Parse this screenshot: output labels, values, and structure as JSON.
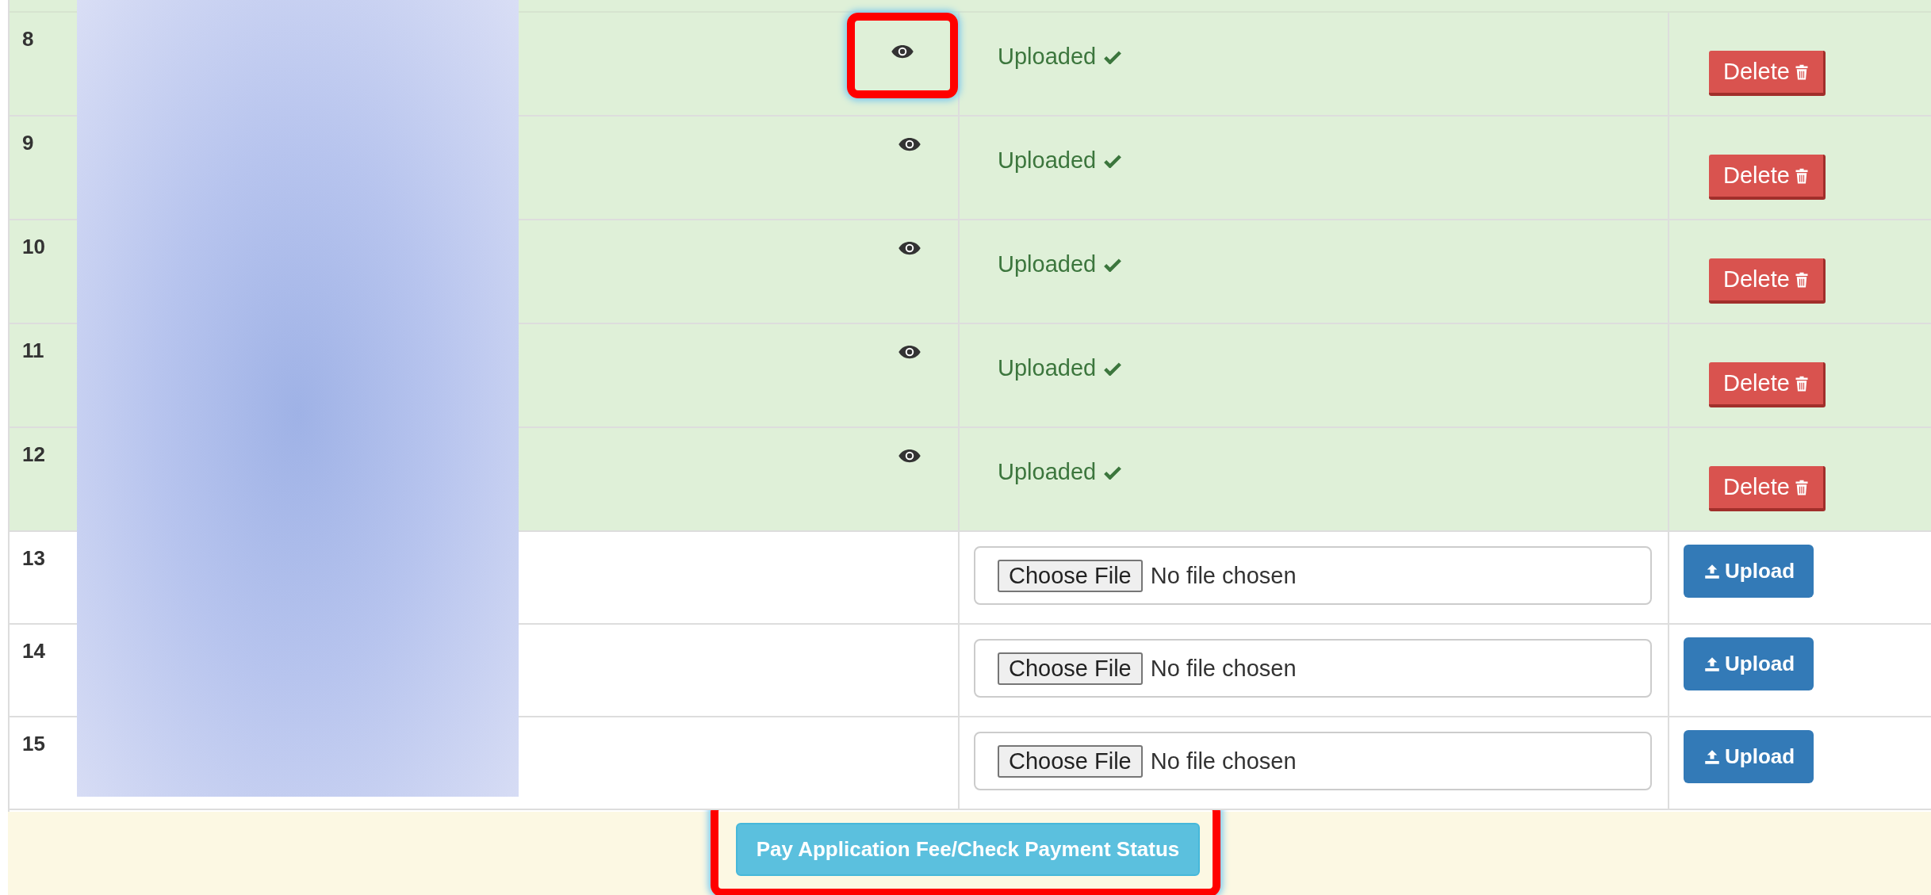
{
  "rows": [
    {
      "number": "8",
      "kind": "uploaded",
      "viewable": true,
      "highlighted": true,
      "status": "Uploaded",
      "action": "Delete"
    },
    {
      "number": "9",
      "kind": "uploaded",
      "viewable": true,
      "highlighted": false,
      "status": "Uploaded",
      "action": "Delete"
    },
    {
      "number": "10",
      "kind": "uploaded",
      "viewable": true,
      "highlighted": false,
      "status": "Uploaded",
      "action": "Delete"
    },
    {
      "number": "11",
      "kind": "uploaded",
      "viewable": true,
      "highlighted": false,
      "status": "Uploaded",
      "action": "Delete"
    },
    {
      "number": "12",
      "kind": "uploaded",
      "viewable": true,
      "highlighted": false,
      "status": "Uploaded",
      "action": "Delete"
    },
    {
      "number": "13",
      "kind": "pending",
      "file_button": "Choose File",
      "file_text": "No file chosen",
      "action": "Upload"
    },
    {
      "number": "14",
      "kind": "pending",
      "file_button": "Choose File",
      "file_text": "No file chosen",
      "action": "Upload"
    },
    {
      "number": "15",
      "kind": "pending",
      "file_button": "Choose File",
      "file_text": "No file chosen",
      "action": "Upload"
    }
  ],
  "footer": {
    "button": "Pay Application Fee/Check Payment Status",
    "highlighted": true
  }
}
